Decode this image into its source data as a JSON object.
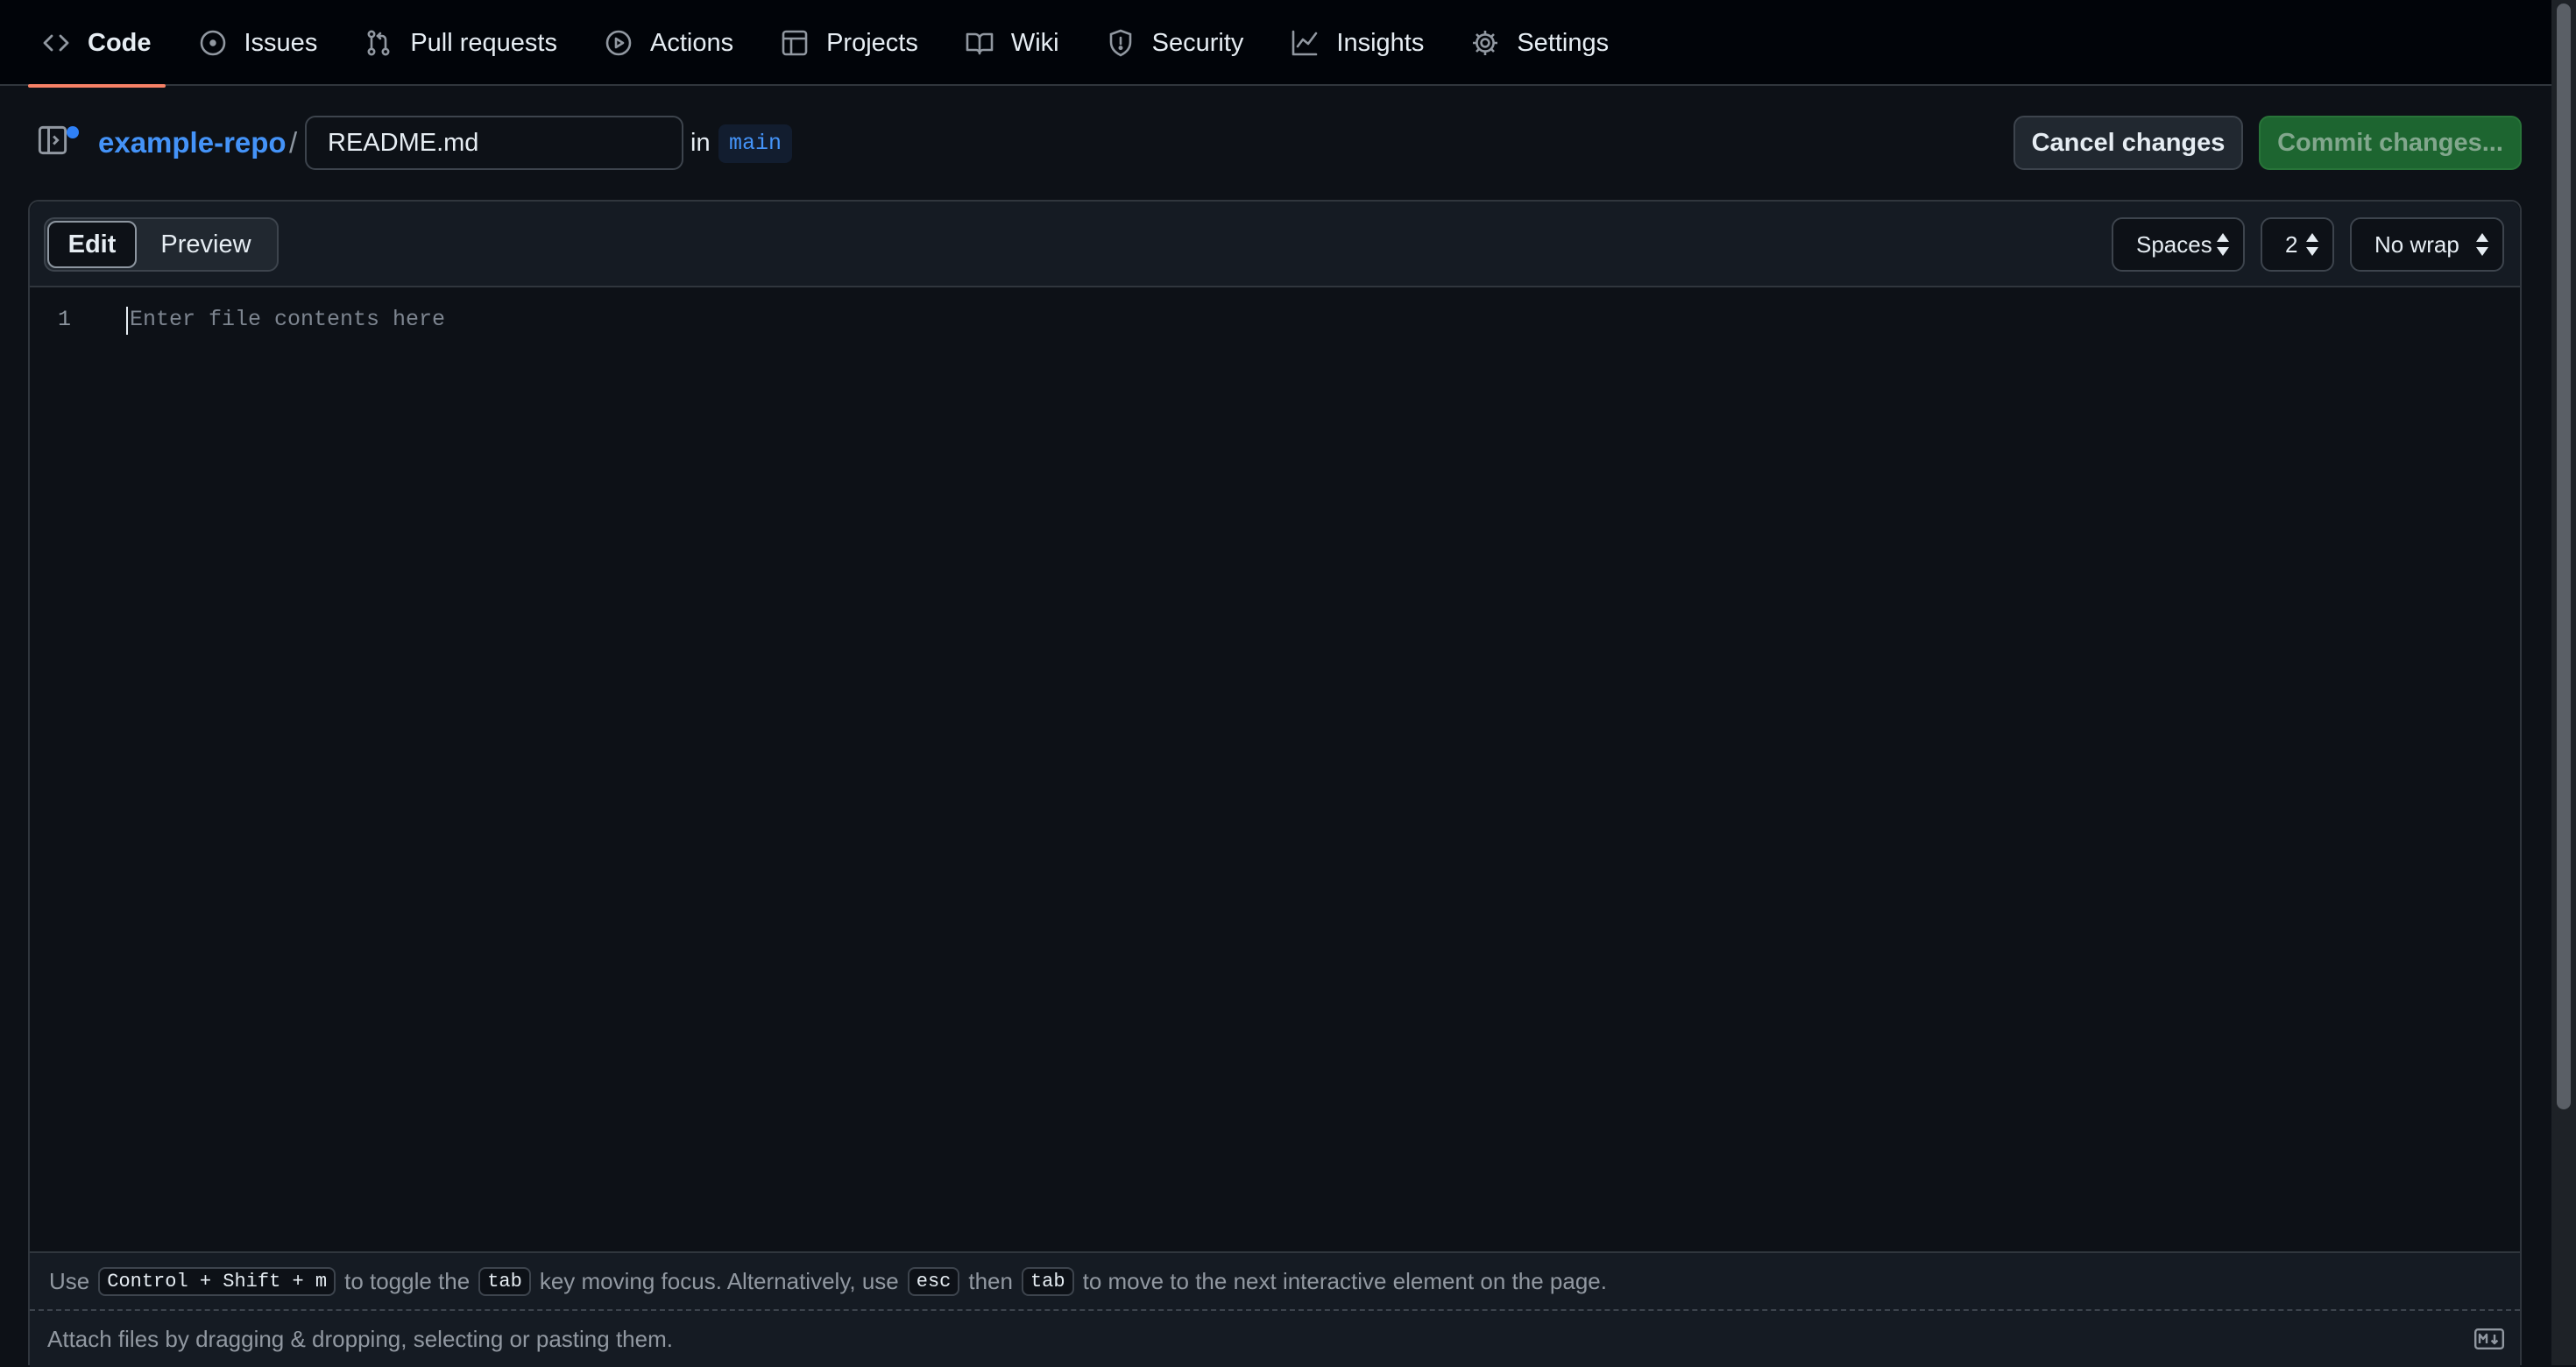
{
  "nav": {
    "tabs": [
      {
        "label": "Code",
        "icon": "code-icon",
        "selected": true
      },
      {
        "label": "Issues",
        "icon": "issue-opened-icon"
      },
      {
        "label": "Pull requests",
        "icon": "git-pull-request-icon"
      },
      {
        "label": "Actions",
        "icon": "play-icon"
      },
      {
        "label": "Projects",
        "icon": "table-icon"
      },
      {
        "label": "Wiki",
        "icon": "book-icon"
      },
      {
        "label": "Security",
        "icon": "shield-icon"
      },
      {
        "label": "Insights",
        "icon": "graph-icon"
      },
      {
        "label": "Settings",
        "icon": "gear-icon"
      }
    ]
  },
  "header": {
    "repo": "example-repo",
    "separator": "/",
    "filename": "README.md",
    "in_label": "in",
    "branch": "main",
    "cancel_label": "Cancel changes",
    "commit_label": "Commit changes..."
  },
  "editor": {
    "edit_label": "Edit",
    "preview_label": "Preview",
    "indent_mode": "Spaces",
    "indent_size": "2",
    "wrap_mode": "No wrap",
    "line_number": "1",
    "placeholder": "Enter file contents here"
  },
  "hint": {
    "t1": "Use",
    "k1": "Control + Shift + m",
    "t2": "to toggle the",
    "k2": "tab",
    "t3": "key moving focus. Alternatively, use",
    "k3": "esc",
    "t4": "then",
    "k4": "tab",
    "t5": "to move to the next interactive element on the page."
  },
  "attach": {
    "text": "Attach files by dragging & dropping, selecting or pasting them.",
    "icon": "markdown-icon"
  },
  "colors": {
    "background": "#0d1117",
    "accent_blue": "#4493f8",
    "tab_underline": "#f78166",
    "commit_green": "#1f6f33"
  }
}
